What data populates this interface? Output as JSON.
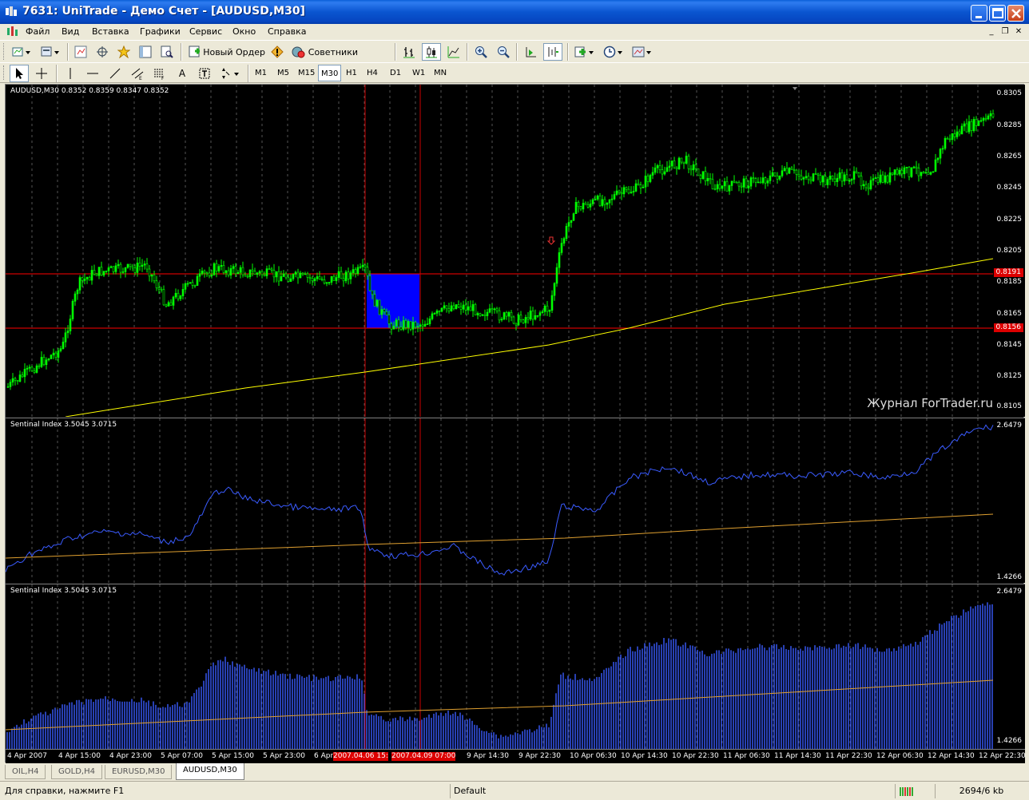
{
  "window": {
    "title": "7631: UniTrade - Демо Счет - [AUDUSD,M30]"
  },
  "menu": {
    "items": [
      "Файл",
      "Вид",
      "Вставка",
      "Графики",
      "Сервис",
      "Окно",
      "Справка"
    ]
  },
  "toolbar": {
    "new_order_label": "Новый Ордер",
    "advisors_label": "Советники",
    "timeframes": [
      "M1",
      "M5",
      "M15",
      "M30",
      "H1",
      "H4",
      "D1",
      "W1",
      "MN"
    ],
    "active_timeframe": "M30",
    "text_tool_label": "A"
  },
  "chart": {
    "symbol_info": "AUDUSD,M30  0.8352 0.8359 0.8347 0.8352",
    "price_axis": [
      "0.8305",
      "0.8285",
      "0.8265",
      "0.8245",
      "0.8225",
      "0.8205",
      "0.8185",
      "0.8165",
      "0.8145",
      "0.8125",
      "0.8105"
    ],
    "price_tag_1": "0.8191",
    "price_tag_2": "0.8156",
    "watermark": "Журнал ForTrader.ru",
    "indicator1_label": "Sentinal Index 3.5045 3.0715",
    "indicator1_max": "2.6479",
    "indicator1_min": "1.4266",
    "indicator2_label": "Sentinal Index 3.5045 3.0715",
    "indicator2_max": "2.6479",
    "indicator2_min": "1.4266",
    "time_axis": [
      "4 Apr 2007",
      "4 Apr 15:00",
      "4 Apr 23:00",
      "5 Apr 07:00",
      "5 Apr 15:00",
      "5 Apr 23:00",
      "6 Apr",
      "9 Apr 14:30",
      "9 Apr 22:30",
      "10 Apr 06:30",
      "10 Apr 14:30",
      "10 Apr 22:30",
      "11 Apr 06:30",
      "11 Apr 14:30",
      "11 Apr 22:30",
      "12 Apr 06:30",
      "12 Apr 14:30",
      "12 Apr 22:30"
    ],
    "time_highlight_1": "2007.04.06 15:",
    "time_highlight_2": "2007.04.09 07:00",
    "colors": {
      "background": "#000000",
      "candles": "#00ff00",
      "ma_line": "#ffff00",
      "index_line": "#3a5bff",
      "index_ma": "#e0a030",
      "hlines": "#ff0000",
      "rect": "#0000ff"
    }
  },
  "tabs": {
    "items": [
      "OIL,H4",
      "GOLD,H4",
      "EURUSD,M30",
      "AUDUSD,M30"
    ],
    "active": "AUDUSD,M30"
  },
  "statusbar": {
    "help_text": "Для справки, нажмите F1",
    "profile": "Default",
    "traffic": "2694/6 kb"
  }
}
